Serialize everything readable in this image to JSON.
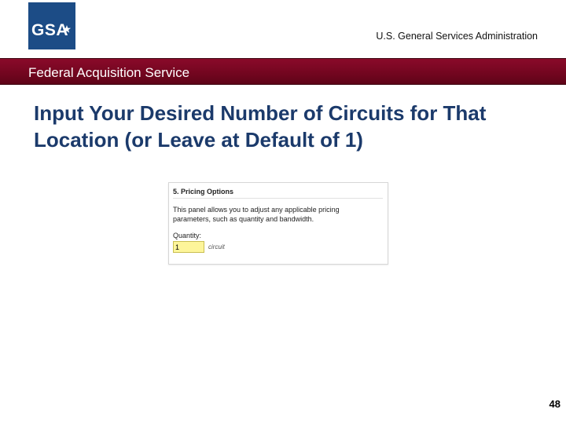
{
  "header": {
    "logo_text": "GSA",
    "agency_name": "U.S. General Services Administration"
  },
  "band": {
    "label": "Federal Acquisition Service"
  },
  "slide": {
    "title": "Input Your Desired Number of Circuits for That Location (or Leave at Default of 1)",
    "page_number": "48"
  },
  "panel": {
    "heading": "5. Pricing Options",
    "description": "This panel allows you to adjust any applicable pricing parameters, such as quantity and bandwidth.",
    "quantity_label": "Quantity:",
    "quantity_value": "1",
    "quantity_unit": "circuit"
  },
  "colors": {
    "logo_bg": "#1c4c86",
    "band": "#740620",
    "title": "#1b3a6b",
    "quantity_input_bg": "#fdf59a"
  },
  "icons": {
    "logo": "gsa-star-logo"
  }
}
